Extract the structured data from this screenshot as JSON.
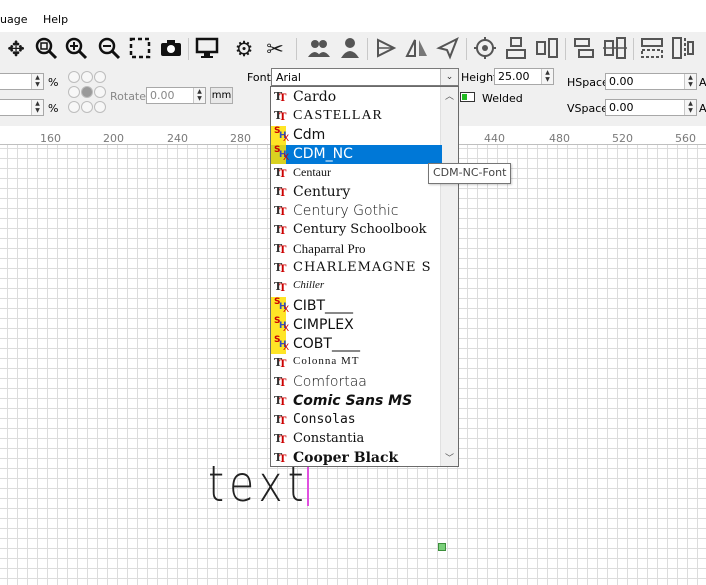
{
  "menu": {
    "language": "uage",
    "help": "Help"
  },
  "toolbar": {
    "icons": [
      "move-icon",
      "zoom-fit-icon",
      "zoom-in-icon",
      "zoom-out-icon",
      "zoom-selection-icon",
      "camera-icon",
      "monitor-icon",
      "settings-icon",
      "tools-icon",
      "users-icon",
      "user-icon",
      "mirror-icon",
      "flip-icon",
      "arrow-icon",
      "target-icon",
      "align-icon",
      "distribute-icon",
      "align-top-icon",
      "align-center-icon",
      "group-icon",
      "ungroup-icon"
    ]
  },
  "props": {
    "percent1": "%",
    "percent2": "%",
    "rotate_label": "Rotate",
    "rotate_value": "0.00",
    "mm_label": "mm",
    "font_label": "Font",
    "font_value": "Arial",
    "height_label": "Height",
    "height_value": "25.00",
    "welded_label": "Welded",
    "hspace_label": "HSpace",
    "hspace_value": "0.00",
    "vspace_label": "VSpace",
    "vspace_value": "0.00",
    "right_a1": "A",
    "right_a2": "A"
  },
  "ruler": {
    "ticks": [
      "160",
      "200",
      "240",
      "280",
      "440",
      "480",
      "520",
      "560"
    ]
  },
  "dropdown": {
    "items": [
      {
        "name": "Cardo",
        "icon": "truetype-icon"
      },
      {
        "name": "CASTELLAR",
        "icon": "truetype-icon"
      },
      {
        "name": "Cdm",
        "icon": "shx-icon"
      },
      {
        "name": "CDM_NC",
        "icon": "shx-icon",
        "selected": true
      },
      {
        "name": "Centaur",
        "icon": "truetype-icon"
      },
      {
        "name": "Century",
        "icon": "truetype-icon"
      },
      {
        "name": "Century Gothic",
        "icon": "truetype-icon"
      },
      {
        "name": "Century Schoolbook",
        "icon": "truetype-icon"
      },
      {
        "name": "Chaparral Pro",
        "icon": "truetype-icon"
      },
      {
        "name": "CHARLEMAGNE S",
        "icon": "truetype-icon"
      },
      {
        "name": "Chiller",
        "icon": "truetype-icon"
      },
      {
        "name": "CIBT____",
        "icon": "shx-icon"
      },
      {
        "name": "CIMPLEX",
        "icon": "shx-icon"
      },
      {
        "name": "COBT____",
        "icon": "shx-icon"
      },
      {
        "name": "Colonna MT",
        "icon": "truetype-icon"
      },
      {
        "name": "Comfortaa",
        "icon": "truetype-icon"
      },
      {
        "name": "Comic Sans MS",
        "icon": "truetype-icon"
      },
      {
        "name": "Consolas",
        "icon": "truetype-icon"
      },
      {
        "name": "Constantia",
        "icon": "truetype-icon"
      },
      {
        "name": "Cooper Black",
        "icon": "truetype-icon"
      }
    ]
  },
  "tooltip": "CDM-NC-Font",
  "canvas": {
    "text": "text"
  }
}
